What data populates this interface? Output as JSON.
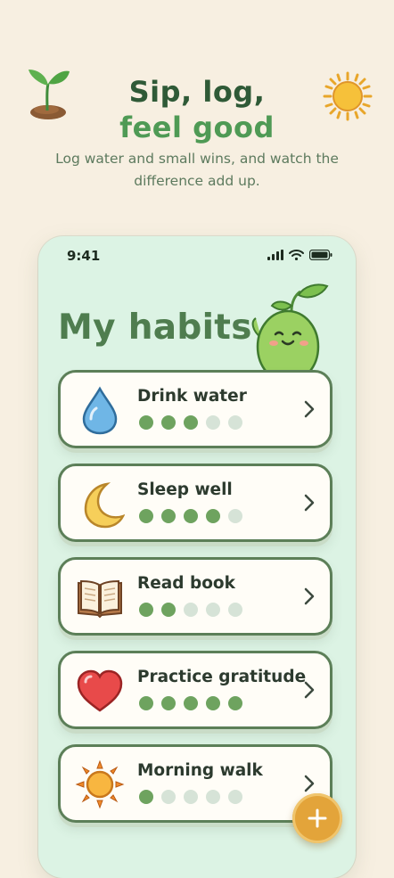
{
  "hero": {
    "headline_line1": "Sip, log,",
    "headline_line2": "feel good",
    "subtitle": "Log water and small wins, and watch the difference add up.",
    "decor_left_icon": "sprout-icon",
    "decor_right_icon": "sun-icon"
  },
  "status_bar": {
    "time": "9:41",
    "icons": [
      "signal-icon",
      "wifi-icon",
      "battery-icon"
    ]
  },
  "screen": {
    "title": "My habits",
    "mascot": "pea-mascot-icon"
  },
  "habits": [
    {
      "name": "Drink water",
      "icon": "water-drop-icon",
      "progress": [
        1,
        1,
        1,
        0,
        0
      ]
    },
    {
      "name": "Sleep well",
      "icon": "moon-icon",
      "progress": [
        1,
        1,
        1,
        1,
        0
      ]
    },
    {
      "name": "Read book",
      "icon": "book-icon",
      "progress": [
        1,
        1,
        0,
        0,
        0
      ]
    },
    {
      "name": "Practice gratitude",
      "icon": "heart-icon",
      "progress": [
        1,
        1,
        1,
        1,
        1
      ]
    },
    {
      "name": "Morning walk",
      "icon": "sun-icon",
      "progress": [
        1,
        0,
        0,
        0,
        0
      ]
    }
  ],
  "fab": {
    "icon": "plus-icon"
  },
  "colors": {
    "background": "#f7efe1",
    "phone": "#dcf3e4",
    "accent_green": "#6ea35f",
    "headline_dark": "#2f5a37",
    "headline_light": "#4f9a55",
    "fab": "#e3a43a"
  }
}
